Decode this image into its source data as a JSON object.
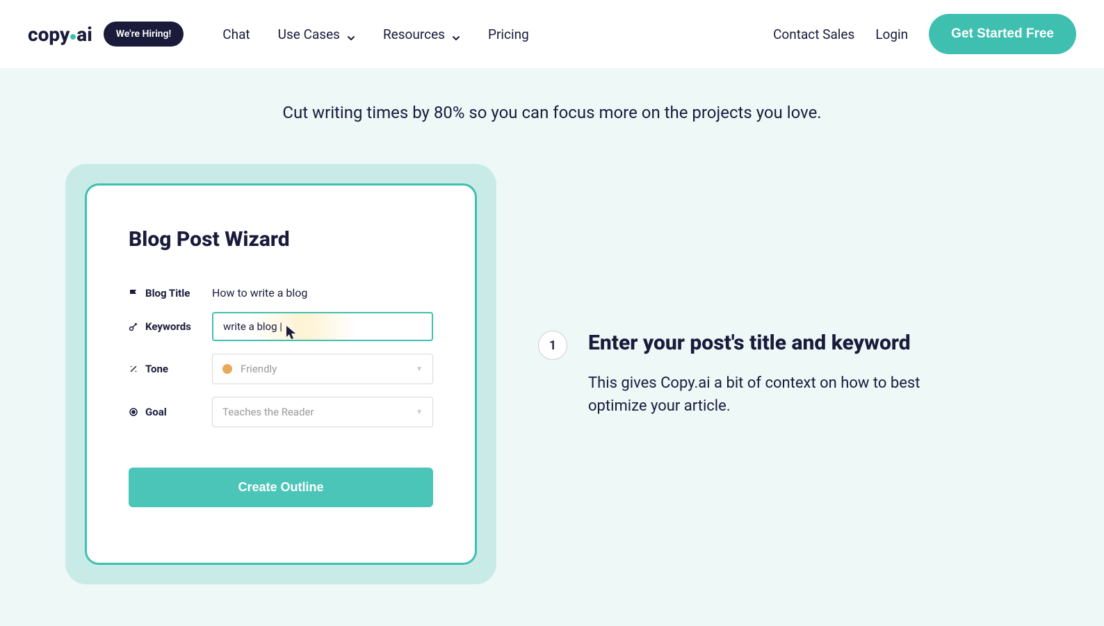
{
  "header": {
    "logo_part1": "copy",
    "logo_part2": "ai",
    "hiring_badge": "We're Hiring!",
    "nav": {
      "chat": "Chat",
      "use_cases": "Use Cases",
      "resources": "Resources",
      "pricing": "Pricing"
    },
    "contact_sales": "Contact Sales",
    "login": "Login",
    "cta": "Get Started Free"
  },
  "hero": {
    "subtitle": "Cut writing times by 80% so you can focus more on the projects you love."
  },
  "wizard": {
    "title": "Blog Post Wizard",
    "fields": {
      "blog_title": {
        "label": "Blog Title",
        "value": "How to write a blog"
      },
      "keywords": {
        "label": "Keywords",
        "value": "write a blog |"
      },
      "tone": {
        "label": "Tone",
        "placeholder": "Friendly"
      },
      "goal": {
        "label": "Goal",
        "placeholder": "Teaches the Reader"
      }
    },
    "submit": "Create Outline"
  },
  "step": {
    "number": "1",
    "title": "Enter your post's title and keyword",
    "description": "This gives Copy.ai a bit of context on how to best optimize your article."
  }
}
